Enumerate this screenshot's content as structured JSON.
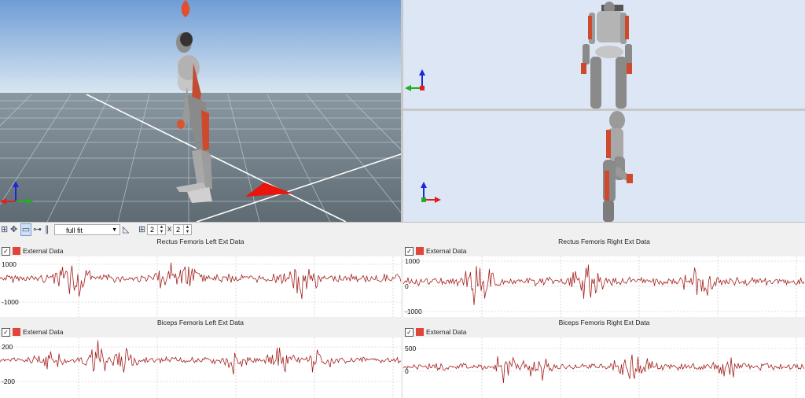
{
  "viewports": {
    "main": {
      "name": "perspective-view"
    },
    "front": {
      "name": "front-view"
    },
    "side": {
      "name": "side-view"
    }
  },
  "toolbar": {
    "icons": [
      "layout-icon",
      "move-icon",
      "view-icon",
      "hierarchy-icon",
      "columns-icon"
    ],
    "fit_select": "full fit",
    "rows": "2",
    "times": "x",
    "cols": "2"
  },
  "plots": [
    {
      "title": "Rectus Femoris Left Ext Data",
      "legend": "External Data",
      "ticks": [
        "1000",
        "-1000"
      ]
    },
    {
      "title": "Rectus Femoris Right Ext Data",
      "legend": "External Data",
      "ticks": [
        "1000",
        "0",
        "-1000"
      ]
    },
    {
      "title": "Biceps Femoris Left Ext Data",
      "legend": "External Data",
      "ticks": [
        "200",
        "-200"
      ]
    },
    {
      "title": "Biceps Femoris Right Ext Data",
      "legend": "External Data",
      "ticks": [
        "500",
        "0"
      ]
    }
  ],
  "colors": {
    "signal": "#a3201e",
    "legend_swatch": "#e0453b",
    "sky_top": "#7ea7d8",
    "floor": "#6f7c85"
  }
}
